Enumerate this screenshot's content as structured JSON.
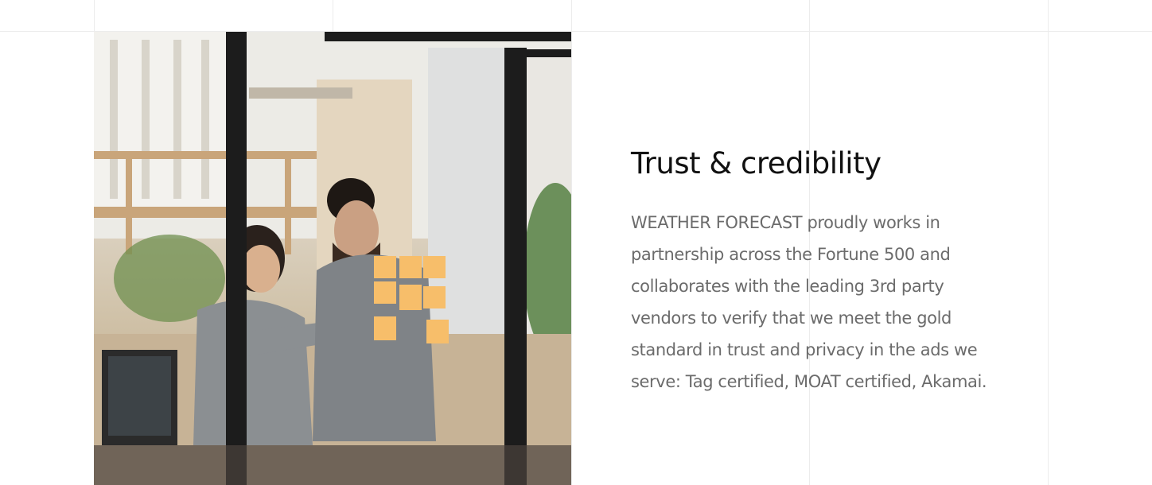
{
  "section": {
    "title": "Trust & credibility",
    "body": "WEATHER FORECAST proudly works in partnership across the Fortune 500 and collaborates with the leading 3rd party vendors to verify that we meet the gold standard in trust and privacy in the ads we serve: Tag certified, MOAT certified, Akamai."
  },
  "colors": {
    "title": "#111111",
    "body": "#6b6b6b",
    "grid_line": "#ececec",
    "sticky_note": "#f7be6a"
  },
  "image": {
    "subject": "team-collaborating-with-sticky-notes-photo"
  }
}
